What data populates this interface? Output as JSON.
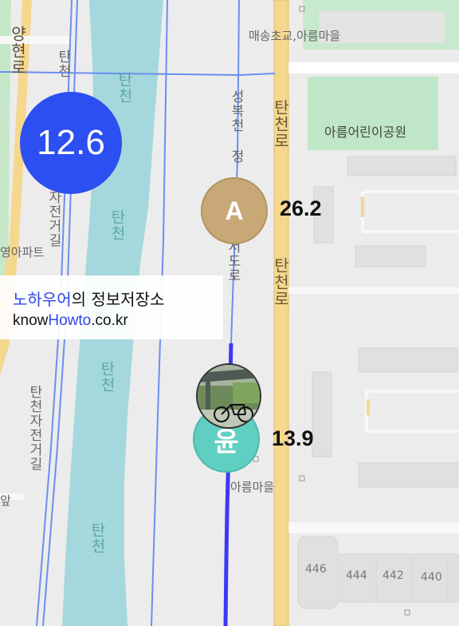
{
  "colors": {
    "route": "#3a3af5",
    "accent_circle": "#2b4ff0",
    "marker_a": "#c8a876",
    "marker_user": "#5fcfc2",
    "river": "#a5d8dc",
    "road": "#f5d78e",
    "park": "#bfe6c6"
  },
  "map": {
    "labels": {
      "school_area": "매송초교,아름마을",
      "park": "아름어린이공원",
      "place_bottom": "아름마을",
      "apartment_fragment": "영아파트",
      "left_edge_fragment": "앞",
      "left_road": "양현로",
      "bike_path_left_top": "탄천",
      "bike_path_left_mid": "자전거길",
      "bike_path_left_bottom": "탄천자전거길",
      "river_1": "탄천",
      "river_2": "탄천",
      "river_3": "탄천",
      "river_4": "탄천",
      "river_5": "탄천",
      "main_road_1": "탄천로",
      "main_road_2": "탄천로",
      "stream_path_top": "성복천 정",
      "stream_path_bottom": "서도로",
      "house_1": "446",
      "house_2": "444",
      "house_3": "442",
      "house_4": "440"
    }
  },
  "overlay": {
    "speed_circle_value": "12.6",
    "marker_a": {
      "letter": "A",
      "value": "26.2"
    },
    "marker_user": {
      "letter": "윤",
      "value": "13.9"
    }
  },
  "info_box": {
    "brand_highlight": "노하우어",
    "brand_rest": "의 정보저장소",
    "url_prefix": "know",
    "url_highlight": "Howto",
    "url_suffix": ".co.kr"
  }
}
